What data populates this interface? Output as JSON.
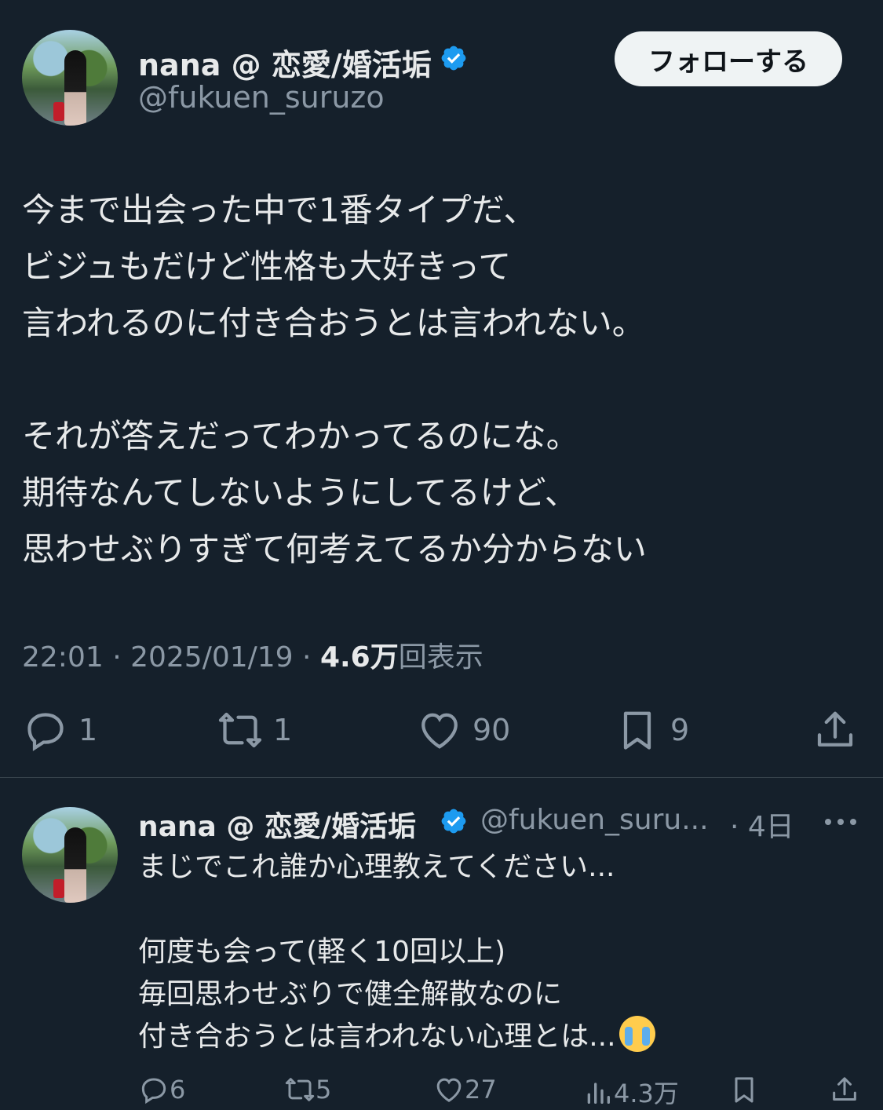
{
  "tweet": {
    "display_name": "nana @ 恋愛/婚活垢",
    "handle": "@fukuen_suruzo",
    "follow_label": "フォローする",
    "text": "今まで出会った中で1番タイプだ、\nビジュもだけど性格も大好きって\n言われるのに付き合おうとは言われない。\n\nそれが答えだってわかってるのにな。\n期待なんてしないようにしてるけど、\n思わせぶりすぎて何考えてるか分からない",
    "time": "22:01",
    "date": "2025/01/19",
    "views_count": "4.6万",
    "views_label": "回表示",
    "replies": "1",
    "retweets": "1",
    "likes": "90",
    "bookmarks": "9"
  },
  "reply": {
    "display_name": "nana @ 恋愛/婚活垢",
    "handle": "@fukuen_suru...",
    "age": "· 4日",
    "text": "まじでこれ誰か心理教えてください...\n\n何度も会って(軽く10回以上)\n毎回思わせぶりで健全解散なのに\n付き合おうとは言われない心理とは...",
    "replies": "6",
    "retweets": "5",
    "likes": "27",
    "views": "4.3万"
  },
  "colors": {
    "background": "#15202b",
    "text": "#e7e9ea",
    "secondary": "#8b98a5",
    "verified": "#1d9bf0"
  }
}
